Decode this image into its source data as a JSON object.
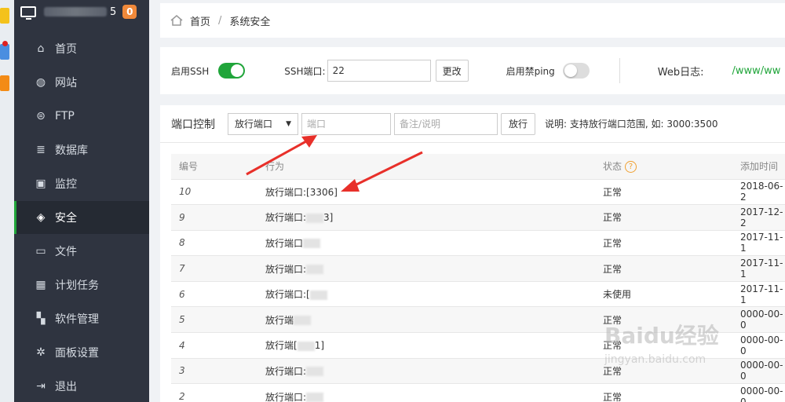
{
  "sidebar": {
    "server_num": "5",
    "badge": "0",
    "items": [
      {
        "label": "首页",
        "icon": "home-icon"
      },
      {
        "label": "网站",
        "icon": "globe-icon"
      },
      {
        "label": "FTP",
        "icon": "ftp-icon"
      },
      {
        "label": "数据库",
        "icon": "database-icon"
      },
      {
        "label": "监控",
        "icon": "monitor-icon"
      },
      {
        "label": "安全",
        "icon": "shield-icon",
        "active": true
      },
      {
        "label": "文件",
        "icon": "folder-icon"
      },
      {
        "label": "计划任务",
        "icon": "calendar-icon"
      },
      {
        "label": "软件管理",
        "icon": "grid-icon"
      },
      {
        "label": "面板设置",
        "icon": "gear-icon"
      },
      {
        "label": "退出",
        "icon": "logout-icon"
      }
    ]
  },
  "breadcrumb": {
    "home": "首页",
    "sep": "/",
    "current": "系统安全"
  },
  "ssh": {
    "enable_ssh_label": "启用SSH",
    "ssh_port_label": "SSH端口:",
    "ssh_port_value": "22",
    "change_button": "更改",
    "ping_label": "启用禁ping",
    "web_log_label": "Web日志:",
    "web_log_path": "/www/ww"
  },
  "port_control": {
    "title": "端口控制",
    "select_value": "放行端口",
    "port_placeholder": "端口",
    "remark_placeholder": "备注/说明",
    "allow_button": "放行",
    "note": "说明: 支持放行端口范围, 如: 3000:3500",
    "columns": {
      "id": "编号",
      "action": "行为",
      "status": "状态",
      "time": "添加时间"
    },
    "rows": [
      {
        "id": "10",
        "action": "放行端口:[3306]",
        "status": "正常",
        "time": "2018-06-2"
      },
      {
        "id": "9",
        "action": "放行端口:",
        "suffix": "3]",
        "status": "正常",
        "time": "2017-12-2"
      },
      {
        "id": "8",
        "action": "放行端口",
        "status": "正常",
        "time": "2017-11-1"
      },
      {
        "id": "7",
        "action": "放行端口:",
        "status": "正常",
        "time": "2017-11-1"
      },
      {
        "id": "6",
        "action": "放行端口:[",
        "status": "未使用",
        "time": "2017-11-1"
      },
      {
        "id": "5",
        "action": "放行端",
        "status": "正常",
        "time": "0000-00-0"
      },
      {
        "id": "4",
        "action": "放行端[",
        "suffix": "1]",
        "status": "正常",
        "time": "0000-00-0"
      },
      {
        "id": "3",
        "action": "放行端口:",
        "status": "正常",
        "time": "0000-00-0"
      },
      {
        "id": "2",
        "action": "放行端口:",
        "status": "正常",
        "time": "0000-00-0"
      }
    ]
  },
  "watermark": {
    "main": "Baidu经验",
    "sub": "jingyan.baidu.com"
  },
  "colors": {
    "sidebar_bg": "#2f3440",
    "accent_green": "#20a53a",
    "badge_orange": "#f0893a",
    "arrow_red": "#e8302a"
  }
}
